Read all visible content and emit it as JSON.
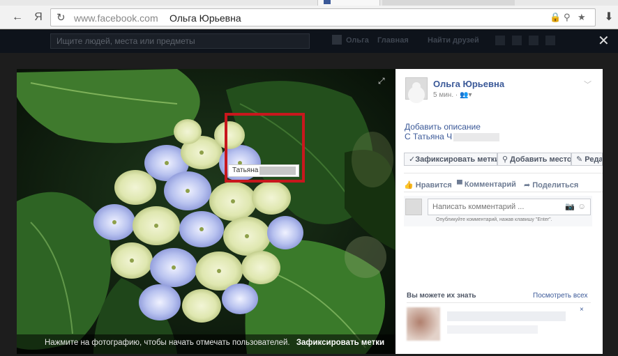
{
  "browser": {
    "back_icon": "←",
    "yandex_logo": "Я",
    "reload_icon": "↻",
    "domain": "www.facebook.com",
    "page_title": "Ольга Юрьевна",
    "lock_icon": "🔒",
    "zoom_icon": "⚲",
    "star_icon": "★",
    "download_icon": "⬇"
  },
  "fb": {
    "search_placeholder": "Ищите людей, места или предметы",
    "nav_user": "Ольга",
    "nav_home": "Главная",
    "nav_find_friends": "Найти друзей",
    "close_icon": "✕"
  },
  "photo": {
    "expand_icon": "⤢",
    "tag_name": "Татьяна",
    "hint": "Нажмите на фотографию, чтобы начать отмечать пользователей.",
    "finish_tagging": "Зафиксировать метки"
  },
  "panel": {
    "author": "Ольга Юрьевна",
    "time": "5 мин. · 👥▾",
    "chevron_icon": "﹀",
    "add_description": "Добавить описание",
    "with_text": "С Татьяна Ч",
    "buttons": {
      "finish_tagging": "✓Зафиксировать метки",
      "add_place": "⚲ Добавить место",
      "edit": "✎ Редактировать"
    },
    "like": "👍 Нравится",
    "comment": "▀ Комментарий",
    "share": "➦ Поделиться",
    "comment_placeholder": "Написать комментарий ...",
    "camera_icon": "📷",
    "smile_icon": "☺",
    "comment_hint": "Опубликуйте комментарий, нажав клавишу \"Enter\".",
    "pymk_title": "Вы можете их знать",
    "pymk_all": "Посмотреть всех",
    "pymk_close": "×"
  },
  "colors": {
    "facebook_blue": "#3b5998",
    "tag_red": "#c8171d"
  }
}
